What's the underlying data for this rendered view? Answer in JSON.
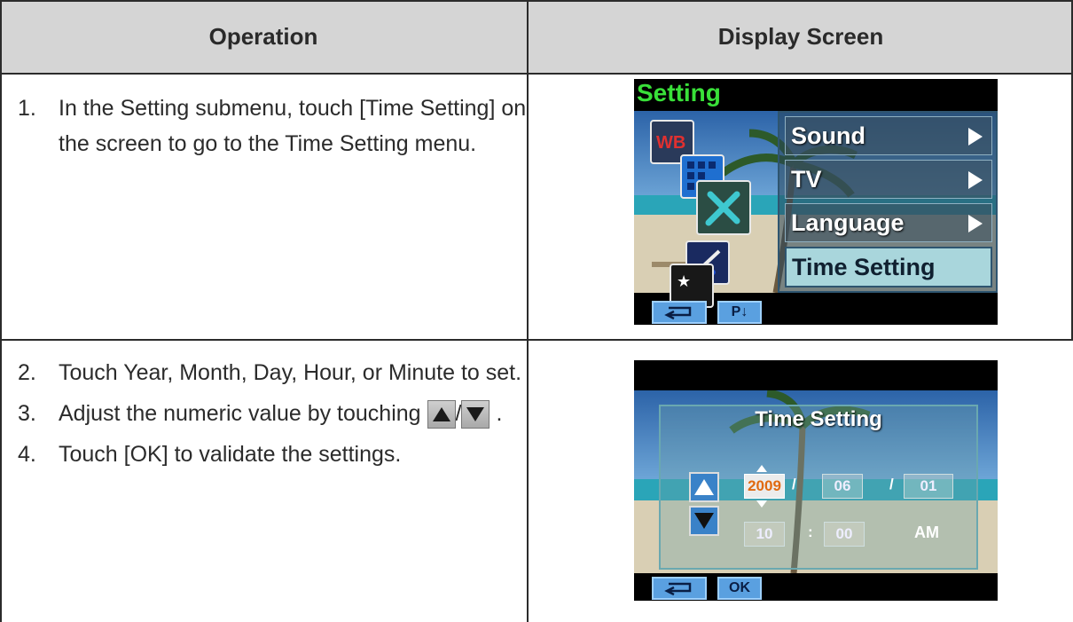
{
  "table": {
    "headers": {
      "operation": "Operation",
      "display": "Display Screen"
    }
  },
  "steps": [
    {
      "num": "1.",
      "lines": [
        "In the Setting submenu, touch [Time Setting] on",
        "the screen to go to the Time Setting menu."
      ]
    },
    {
      "num": "2.",
      "text": "Touch Year, Month, Day, Hour, or Minute to set."
    },
    {
      "num": "3.",
      "text_before": "Adjust the numeric value by touching",
      "slash": "/",
      "text_after": "."
    },
    {
      "num": "4.",
      "text": "Touch [OK] to validate the settings."
    }
  ],
  "screen1": {
    "title": "Setting",
    "menu_items": [
      "Sound",
      "TV",
      "Language",
      "Time Setting"
    ],
    "selected_index": 3,
    "icons": [
      "wb-icon",
      "resolution-icon",
      "tools-icon",
      "pen-icon",
      "night-icon"
    ],
    "toolbar": {
      "back_icon": "return-icon",
      "page_label": "P↓"
    }
  },
  "screen2": {
    "dialog_title": "Time Setting",
    "date": {
      "year": "2009",
      "month": "06",
      "day": "01",
      "sep": "/"
    },
    "time": {
      "hour": "10",
      "minute": "00",
      "sep": ":",
      "ampm": "AM"
    },
    "toolbar": {
      "back_icon": "return-icon",
      "ok_label": "OK"
    }
  },
  "colors": {
    "header_bg": "#d5d5d5",
    "menu_title": "#39e039",
    "selected_item": "#a9d6dc",
    "active_field_text": "#e06a10",
    "button_blue": "#5aa0e0"
  }
}
